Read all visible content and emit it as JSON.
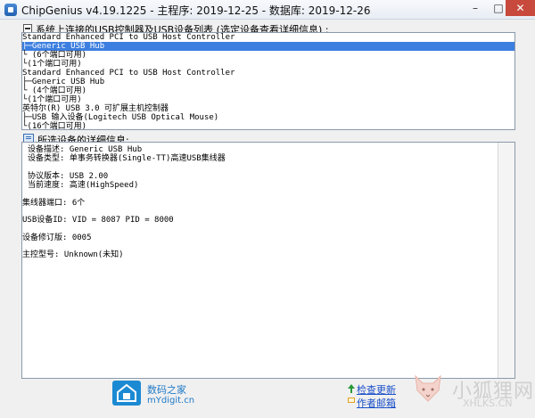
{
  "window": {
    "title": "ChipGenius v4.19.1225 - 主程序: 2019-12-25 - 数据库: 2019-12-26",
    "minimize_glyph": "–",
    "maximize_glyph": "□",
    "close_glyph": "✕"
  },
  "device_section": {
    "label": "系统上连接的USB控制器及USB设备列表 (选定设备查看详细信息) :",
    "items": [
      {
        "text": "Standard Enhanced PCI to USB Host Controller",
        "selected": false
      },
      {
        "text": "├─Generic USB Hub",
        "selected": true
      },
      {
        "text": "  └ (6个端口可用)",
        "selected": false
      },
      {
        "text": "└(1个端口可用)",
        "selected": false
      },
      {
        "text": "Standard Enhanced PCI to USB Host Controller",
        "selected": false
      },
      {
        "text": "├─Generic USB Hub",
        "selected": false
      },
      {
        "text": "  └ (4个端口可用)",
        "selected": false
      },
      {
        "text": "└(1个端口可用)",
        "selected": false
      },
      {
        "text": "英特尔(R) USB 3.0 可扩展主机控制器",
        "selected": false
      },
      {
        "text": "├─USB 输入设备(Logitech USB Optical Mouse)",
        "selected": false
      },
      {
        "text": "└(16个端口可用)",
        "selected": false
      }
    ]
  },
  "details_section": {
    "label": "所选设备的详细信息:",
    "rows": [
      {
        "text": "  设备描述: Generic USB Hub"
      },
      {
        "text": "  设备类型: 单事务转换器(Single-TT)高速USB集线器"
      },
      {
        "text": "  协议版本: USB 2.00"
      },
      {
        "text": "  当前速度: 高速(HighSpeed)"
      },
      {
        "text": "集线器端口: 6个"
      },
      {
        "text": " USB设备ID: VID = 8087 PID = 8000"
      },
      {
        "text": "设备修订版: 0005"
      },
      {
        "text": "  主控型号: Unknown(未知)"
      }
    ]
  },
  "footer": {
    "site_name": "数码之家",
    "site_url": "mYdigit.cn",
    "check_update": "检查更新",
    "author_mail": "作者邮箱",
    "watermark_text": "小狐狸网",
    "watermark_url": "XHLKS.CN"
  },
  "colors": {
    "selection": "#3d7fe0",
    "link": "#1a4fc9",
    "close_button": "#c74a3d",
    "brand_blue": "#1c8ad3"
  }
}
